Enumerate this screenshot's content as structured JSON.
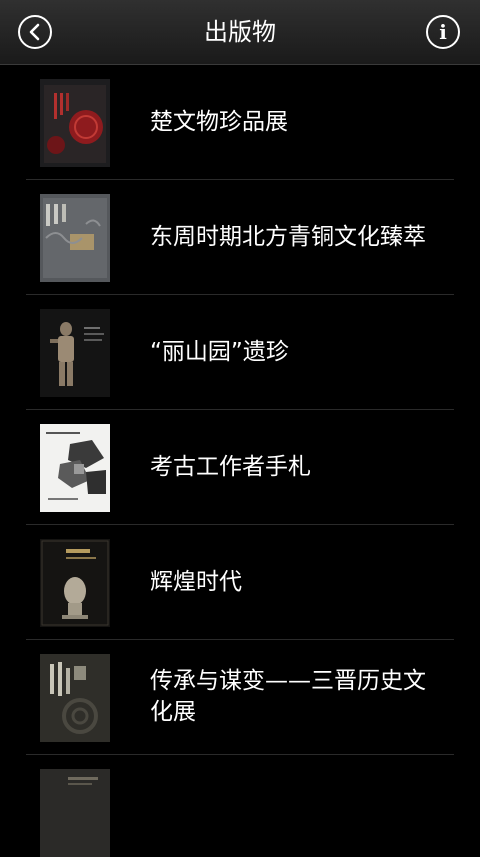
{
  "header": {
    "title": "出版物"
  },
  "publications": [
    {
      "title": "楚文物珍品展",
      "cover": "red-seal-cover"
    },
    {
      "title": "东周时期北方青铜文化臻萃",
      "cover": "grey-bronze-cover"
    },
    {
      "title": "“丽山园”遗珍",
      "cover": "terracotta-figure-cover"
    },
    {
      "title": "考古工作者手札",
      "cover": "white-collage-cover"
    },
    {
      "title": "辉煌时代",
      "cover": "bust-sculpture-cover"
    },
    {
      "title": "传承与谋变——三晋历史文化展",
      "cover": "dark-olive-cover"
    }
  ]
}
